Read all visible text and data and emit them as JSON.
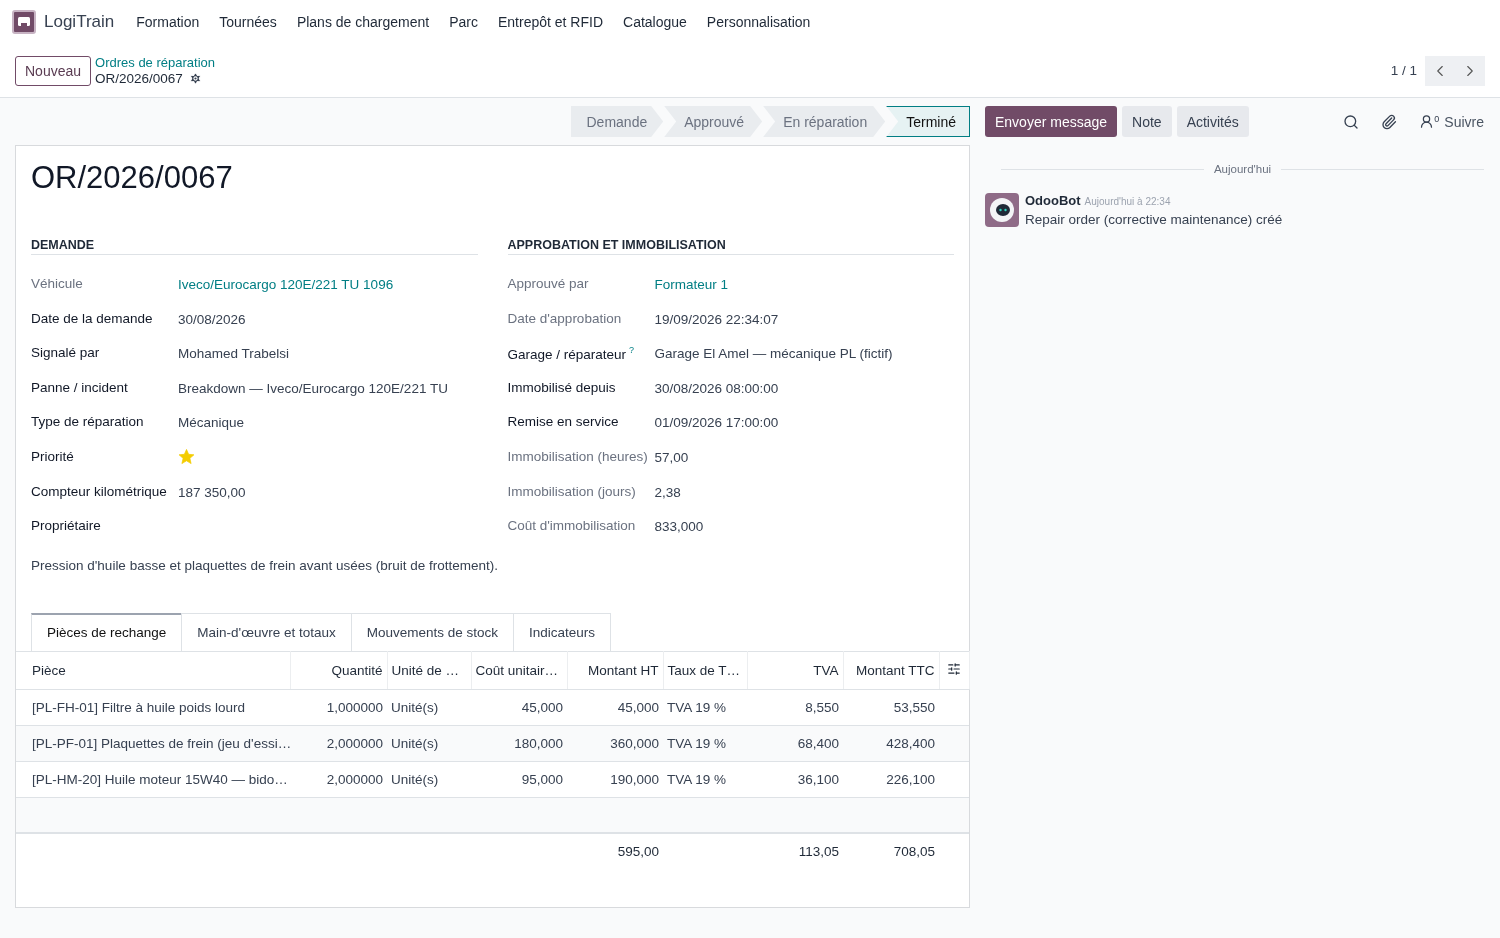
{
  "app": {
    "name": "LogiTrain"
  },
  "menu": [
    "Formation",
    "Tournées",
    "Plans de chargement",
    "Parc",
    "Entrepôt et RFID",
    "Catalogue",
    "Personnalisation"
  ],
  "control_bar": {
    "new_button": "Nouveau",
    "breadcrumb": "Ordres de réparation",
    "record": "OR/2026/0067",
    "pager": "1 / 1"
  },
  "stages": [
    {
      "label": "Demande",
      "selected": false
    },
    {
      "label": "Approuvé",
      "selected": false
    },
    {
      "label": "En réparation",
      "selected": false
    },
    {
      "label": "Terminé",
      "selected": true
    }
  ],
  "title": "OR/2026/0067",
  "groups": [
    {
      "title": "DEMANDE",
      "fields": [
        {
          "label": "Véhicule",
          "muted": true,
          "kind": "link",
          "value": "Iveco/Eurocargo 120E/221 TU 1096"
        },
        {
          "label": "Date de la demande",
          "muted": false,
          "kind": "text",
          "value": "30/08/2026"
        },
        {
          "label": "Signalé par",
          "muted": false,
          "kind": "text",
          "value": "Mohamed Trabelsi"
        },
        {
          "label": "Panne / incident",
          "muted": false,
          "kind": "text",
          "value": "Breakdown — Iveco/Eurocargo 120E/221 TU"
        },
        {
          "label": "Type de réparation",
          "muted": false,
          "kind": "text",
          "value": "Mécanique"
        },
        {
          "label": "Priorité",
          "muted": false,
          "kind": "star",
          "on": true
        },
        {
          "label": "Compteur kilométrique",
          "muted": false,
          "kind": "text",
          "value": "187 350,00"
        },
        {
          "label": "Propriétaire",
          "muted": false,
          "kind": "text"
        }
      ]
    },
    {
      "title": "APPROBATION ET IMMOBILISATION",
      "fields": [
        {
          "label": "Approuvé par",
          "muted": true,
          "kind": "link",
          "value": "Formateur 1"
        },
        {
          "label": "Date d'approbation",
          "muted": true,
          "kind": "text",
          "value": "19/09/2026 22:34:07"
        },
        {
          "label": "Garage / réparateur",
          "help": "?",
          "muted": false,
          "kind": "text",
          "value": "Garage El Amel — mécanique PL (fictif)"
        },
        {
          "label": "Immobilisé depuis",
          "muted": false,
          "kind": "text",
          "value": "30/08/2026 08:00:00"
        },
        {
          "label": "Remise en service",
          "muted": false,
          "kind": "text",
          "value": "01/09/2026 17:00:00"
        },
        {
          "label": "Immobilisation (heures)",
          "muted": true,
          "kind": "text",
          "value": "57,00"
        },
        {
          "label": "Immobilisation (jours)",
          "muted": true,
          "kind": "text",
          "value": "2,38"
        },
        {
          "label": "Coût d'immobilisation",
          "muted": true,
          "kind": "text",
          "value": "833,000"
        }
      ]
    }
  ],
  "description": "Pression d'huile basse et plaquettes de frein avant usées (bruit de frottement).",
  "tabs": [
    {
      "label": "Pièces de rechange",
      "selected": true
    },
    {
      "label": "Main-d'œuvre et totaux",
      "selected": false
    },
    {
      "label": "Mouvements de stock",
      "selected": false
    },
    {
      "label": "Indicateurs",
      "selected": false
    }
  ],
  "table": {
    "columns": [
      "Pièce",
      "Quantité",
      "Unité de …",
      "Coût unitair…",
      "Montant HT",
      "Taux de T…",
      "TVA",
      "Montant TTC"
    ],
    "rows": [
      [
        "[PL-FH-01] Filtre à huile poids lourd",
        "1,000000",
        "Unité(s)",
        "45,000",
        "45,000",
        "TVA 19 %",
        "8,550",
        "53,550"
      ],
      [
        "[PL-PF-01] Plaquettes de frein (jeu d'essi…",
        "2,000000",
        "Unité(s)",
        "180,000",
        "360,000",
        "TVA 19 %",
        "68,400",
        "428,400"
      ],
      [
        "[PL-HM-20] Huile moteur 15W40 — bido…",
        "2,000000",
        "Unité(s)",
        "95,000",
        "190,000",
        "TVA 19 %",
        "36,100",
        "226,100"
      ]
    ],
    "totals": {
      "montant_ht": "595,00",
      "tva": "113,05",
      "montant_ttc": "708,05"
    }
  },
  "chatter": {
    "buttons": [
      {
        "label": "Envoyer message",
        "selected": true
      },
      {
        "label": "Note",
        "selected": false
      },
      {
        "label": "Activités",
        "selected": false
      }
    ],
    "followers": "0",
    "follow": "Suivre",
    "date_separator": "Aujourd'hui",
    "messages": [
      {
        "author": "OdooBot",
        "time": "Aujourd'hui à 22:34",
        "body": "Repair order (corrective maintenance) créé"
      }
    ]
  }
}
